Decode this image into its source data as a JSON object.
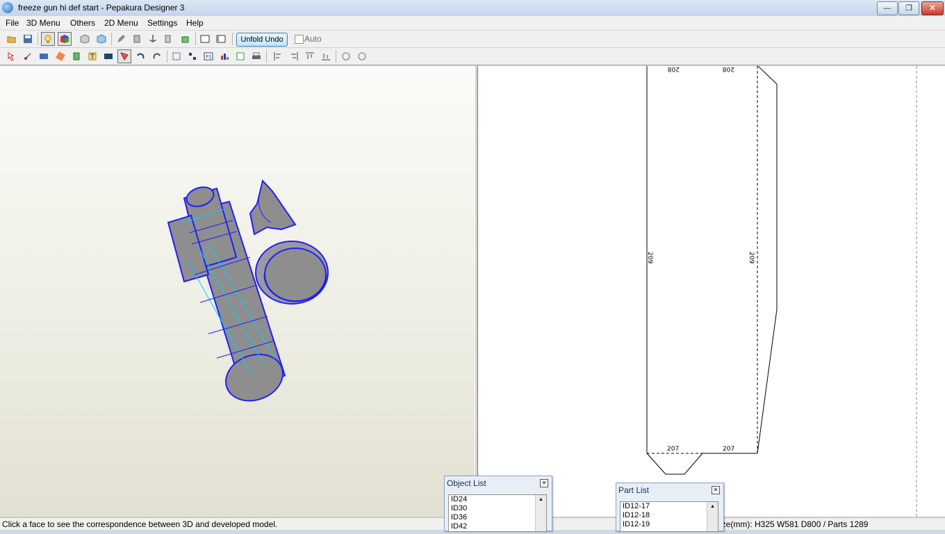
{
  "window": {
    "title": "freeze gun hi def start - Pepakura Designer 3"
  },
  "menu": [
    "File",
    "3D Menu",
    "Others",
    "2D Menu",
    "Settings",
    "Help"
  ],
  "toolbar": {
    "unfold_undo": "Unfold Undo",
    "auto_label": "Auto"
  },
  "pattern": {
    "edge_labels": {
      "top_left": "208",
      "top_right": "208",
      "left": "209",
      "right": "209",
      "bottom_left": "207",
      "bottom_right": "207"
    }
  },
  "object_list": {
    "title": "Object List",
    "items": [
      "ID24",
      "ID30",
      "ID36",
      "ID42"
    ]
  },
  "part_list": {
    "title": "Part List",
    "items": [
      "ID12-17",
      "ID12-18",
      "ID12-19"
    ]
  },
  "status": {
    "message": "Click a face to see the correspondence between 3D and developed model.",
    "size": "ize(mm): H325 W581 D800 / Parts 1289"
  },
  "colors": {
    "wire": "#1e1eff",
    "face": "#8e8e8e",
    "highlight": "#00d0ff"
  }
}
